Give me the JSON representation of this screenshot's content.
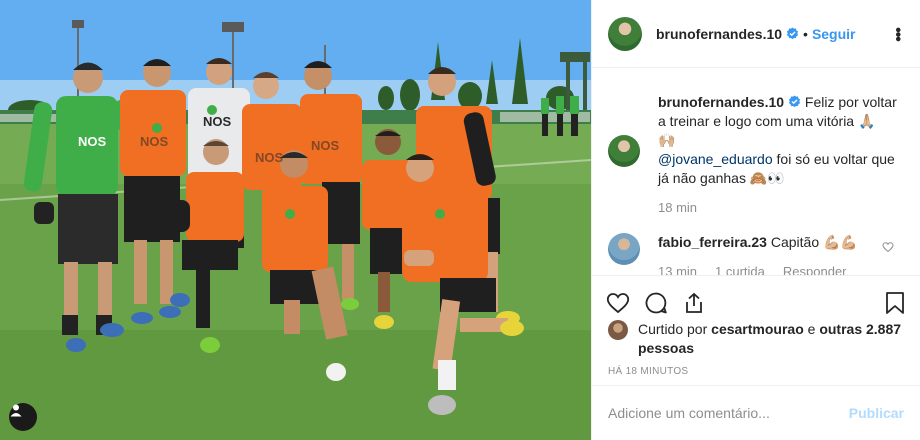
{
  "post": {
    "username": "brunofernandes.10",
    "follow_label": "Seguir",
    "separator": "•",
    "more_glyph": "•••"
  },
  "caption": {
    "username": "brunofernandes.10",
    "text_1": "Feliz por voltar a treinar e logo com uma vitória 🙏🏼",
    "text_2": "🙌🏼",
    "mention": "@jovane_eduardo",
    "text_3": " foi só eu voltar que já não ganhas 🙈👀",
    "time": "18 min"
  },
  "reply": {
    "username": "fabio_ferreira.23",
    "text": "Capitão 💪🏼💪🏼",
    "time": "13 min",
    "likes": "1 curtida",
    "reply_label": "Responder"
  },
  "likes": {
    "prefix": "Curtido por ",
    "user": "cesartmourao",
    "middle": " e ",
    "others": "outras 2.887 pessoas"
  },
  "timestamp": "HÁ 18 MINUTOS",
  "comment_input": {
    "placeholder": "Adicione um comentário...",
    "publish_label": "Publicar"
  },
  "colors": {
    "link_blue": "#3897f0",
    "publish_disabled": "#b3dbff",
    "meta_gray": "#8e8e8e",
    "jersey_orange": "#f06f22",
    "keeper_green": "#3fae49"
  },
  "icons": [
    "verified-icon",
    "more-options-icon",
    "heart-icon",
    "comment-icon",
    "share-icon",
    "bookmark-icon",
    "user-tag-icon"
  ]
}
